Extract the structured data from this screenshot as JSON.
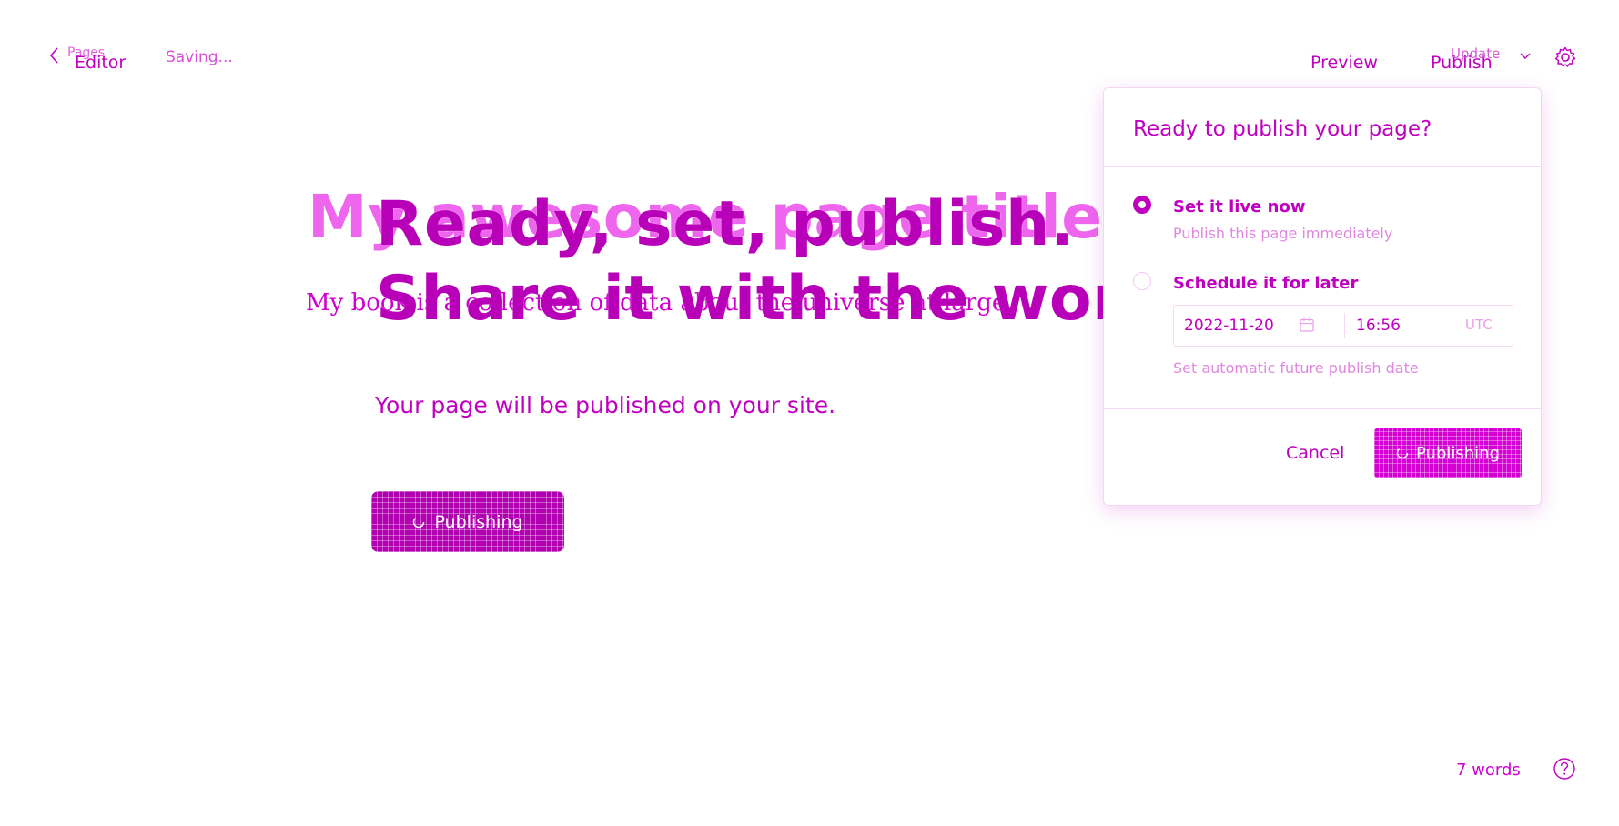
{
  "topbar": {
    "back_previous_label": "Pages",
    "back_label": "Editor",
    "status": "Saving...",
    "preview_label": "Preview",
    "publish_label": "Publish",
    "publish_secondary_label": "Update",
    "back_icon": "chevron-left-icon",
    "menu_icon": "chevron-down-icon",
    "settings_icon": "gear-icon"
  },
  "editor": {
    "title": "My awesome page title",
    "description": "My book is a collection of data about the universe at large."
  },
  "overlay": {
    "headline_line1": "Ready, set, publish.",
    "headline_line2": "Share it with the world.",
    "subtext": "Your page will be published on your site.",
    "button_label": "Publishing"
  },
  "publish_panel": {
    "title": "Ready to publish your page?",
    "options": [
      {
        "label": "Set it live now",
        "description": "Publish this page immediately",
        "selected": true
      },
      {
        "label": "Schedule it for later",
        "description": "Set automatic future publish date",
        "selected": false
      }
    ],
    "schedule_date": "2022-11-20",
    "schedule_time": "16:56",
    "schedule_timezone": "UTC",
    "calendar_icon": "calendar-icon",
    "cancel_label": "Cancel",
    "publish_button_label": "Publishing"
  },
  "footer": {
    "word_count": "7 words",
    "help_icon": "help-icon"
  },
  "colors": {
    "accent": "#c000c0",
    "accent_light": "#ee66ee",
    "background": "#ffffff"
  }
}
